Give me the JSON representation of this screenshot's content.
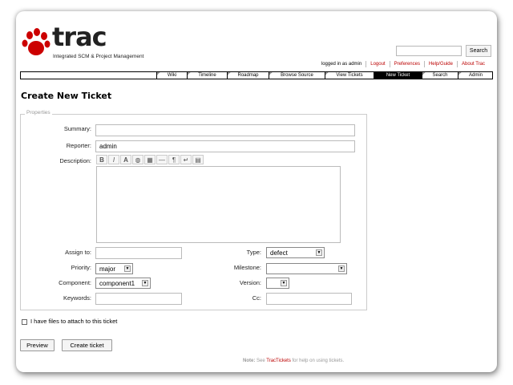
{
  "logo": {
    "text": "trac",
    "subtitle": "Integrated SCM & Project Management"
  },
  "top_search": {
    "value": "",
    "button": "Search"
  },
  "metanav": {
    "logged_in": "logged in as admin",
    "items": [
      "Logout",
      "Preferences",
      "Help/Guide",
      "About Trac"
    ]
  },
  "mainnav": {
    "tabs": [
      "Wiki",
      "Timeline",
      "Roadmap",
      "Browse Source",
      "View Tickets",
      "New Ticket",
      "Search",
      "Admin"
    ],
    "active": "New Ticket"
  },
  "heading": "Create New Ticket",
  "properties": {
    "legend": "Properties",
    "summary_label": "Summary:",
    "summary_value": "",
    "reporter_label": "Reporter:",
    "reporter_value": "admin",
    "description_label": "Description:",
    "toolbar": [
      "B",
      "I",
      "A",
      "◍",
      "▦",
      "—",
      "¶",
      "↵",
      "▤"
    ],
    "assign_label": "Assign to:",
    "assign_value": "",
    "type_label": "Type:",
    "type_value": "defect",
    "priority_label": "Priority:",
    "priority_value": "major",
    "milestone_label": "Milestone:",
    "milestone_value": "",
    "component_label": "Component:",
    "component_value": "component1",
    "version_label": "Version:",
    "version_value": "",
    "keywords_label": "Keywords:",
    "keywords_value": "",
    "cc_label": "Cc:",
    "cc_value": ""
  },
  "attach_label": "I have files to attach to this ticket",
  "buttons": {
    "preview": "Preview",
    "create": "Create ticket"
  },
  "note": {
    "prefix": "Note:",
    "see": "See",
    "link": "TracTickets",
    "suffix": "for help on using tickets."
  }
}
